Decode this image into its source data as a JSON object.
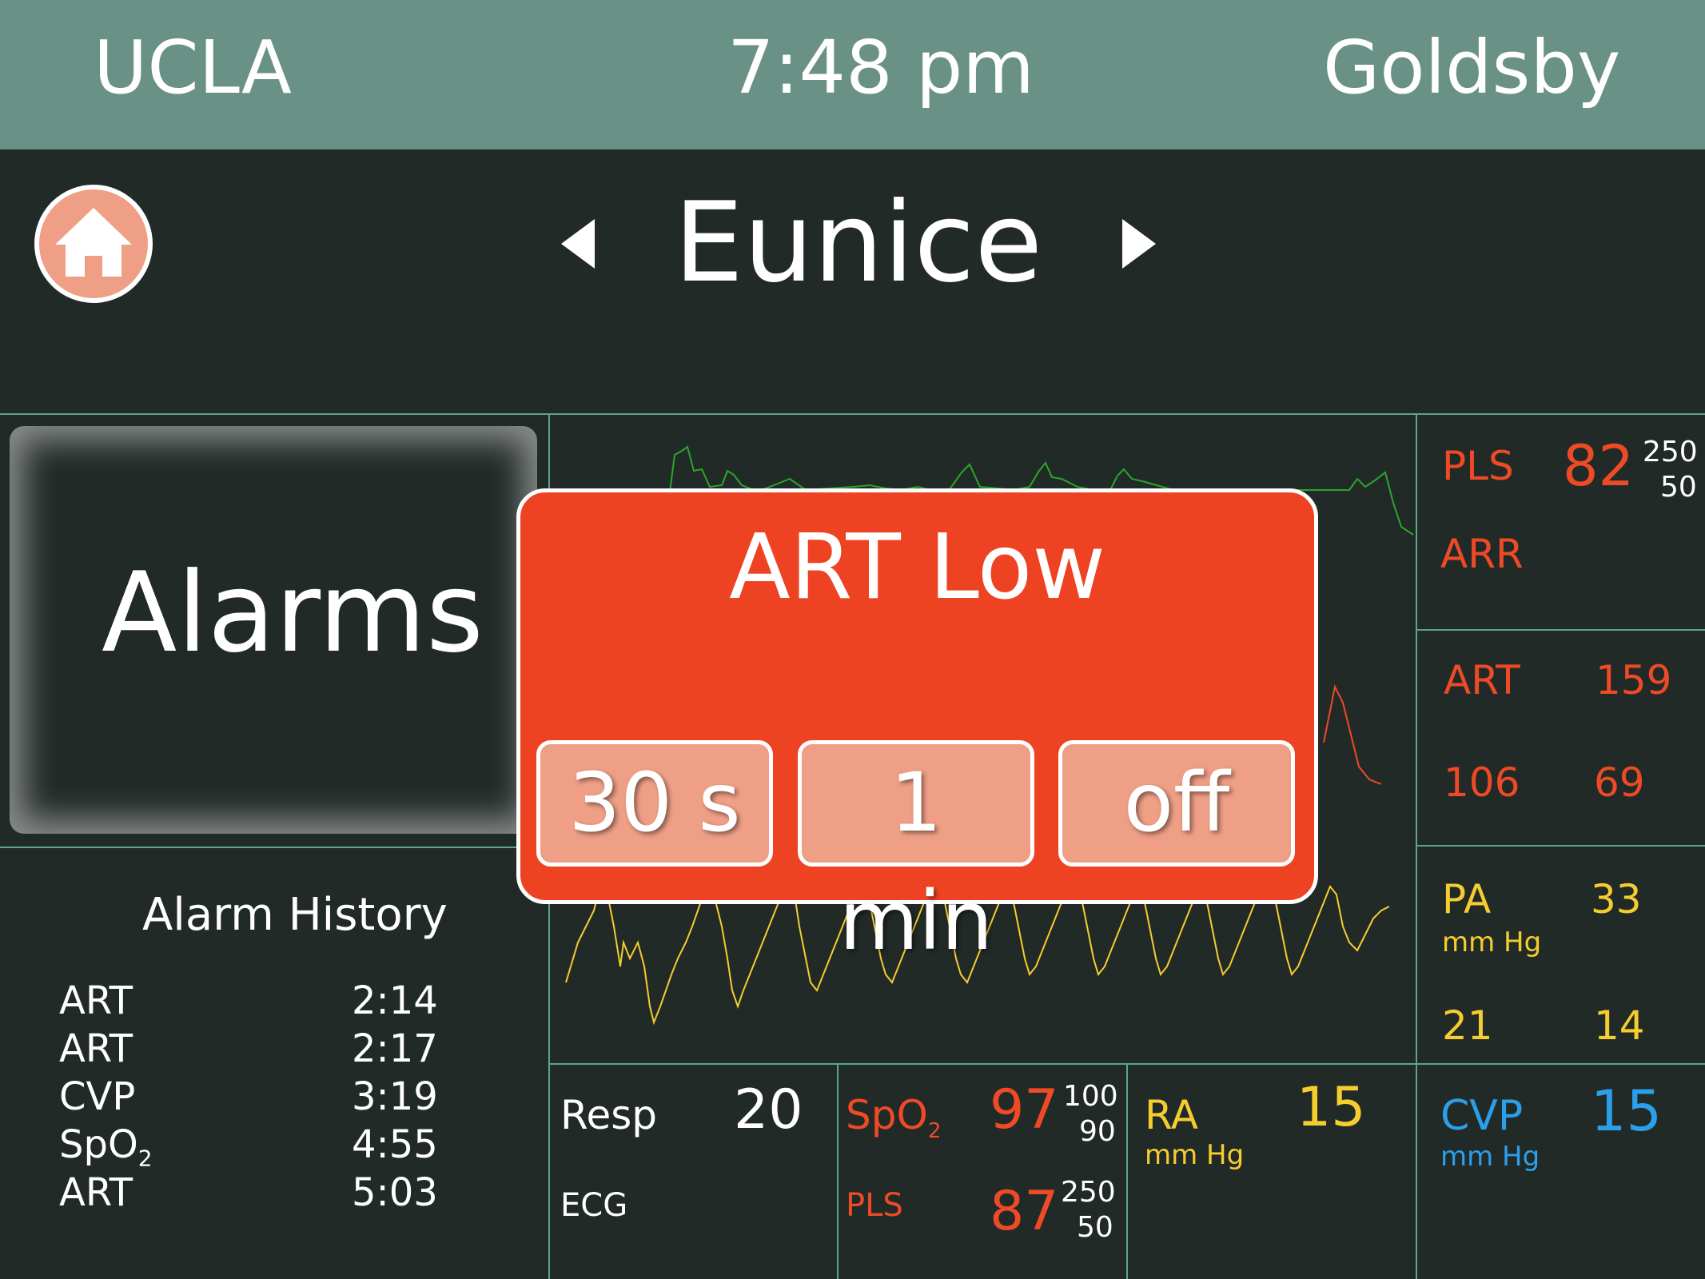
{
  "header": {
    "site": "UCLA",
    "time": "7:48 pm",
    "user": "Goldsby"
  },
  "patient": {
    "name": "Eunice"
  },
  "alarms_button": {
    "label": "Alarms"
  },
  "alarm_history": {
    "title": "Alarm History",
    "entries": [
      {
        "param": "ART",
        "time": "2:14"
      },
      {
        "param": "ART",
        "time": "2:17"
      },
      {
        "param": "CVP",
        "time": "3:19"
      },
      {
        "param": "SpO",
        "param_sub": "2",
        "time": "4:55"
      },
      {
        "param": "ART",
        "time": "5:03"
      }
    ]
  },
  "alert": {
    "title": "ART Low",
    "snooze_options": [
      "30 s",
      "1 min",
      "off"
    ]
  },
  "vitals": {
    "pls": {
      "label": "PLS",
      "value": "82",
      "high": "250",
      "low": "50",
      "rhythm": "ARR"
    },
    "art": {
      "label": "ART",
      "systolic": "159",
      "diastolic": "69",
      "mean": "106"
    },
    "pa": {
      "label": "PA",
      "unit": "mm Hg",
      "systolic": "33",
      "mean": "21",
      "diastolic": "14"
    },
    "cvp": {
      "label": "CVP",
      "unit": "mm Hg",
      "value": "15"
    },
    "resp": {
      "label": "Resp",
      "value": "20",
      "ecg_label": "ECG"
    },
    "spo2": {
      "label": "SpO",
      "label_sub": "2",
      "value": "97",
      "high": "100",
      "low": "90",
      "pls_label": "PLS",
      "pls_value": "87",
      "pls_high": "250",
      "pls_low": "50"
    },
    "ra": {
      "label": "RA",
      "unit": "mm Hg",
      "value": "15"
    }
  },
  "colors": {
    "header_bg": "#6a9185",
    "background": "#222a28",
    "alert_red": "#ee4323",
    "art_red": "#ee4a26",
    "pa_yellow": "#f5cd2f",
    "cvp_blue": "#2b9fea",
    "home_salmon": "#ef9f86",
    "grid": "#5aa58d"
  },
  "icons": {
    "home": "home-icon",
    "prev": "triangle-left-icon",
    "next": "triangle-right-icon"
  }
}
